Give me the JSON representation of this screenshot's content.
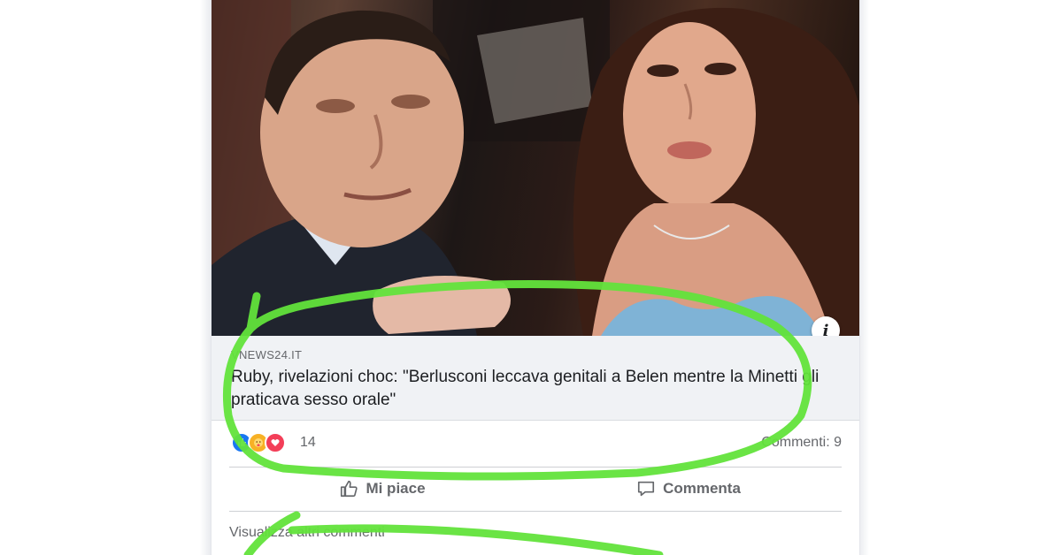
{
  "post": {
    "link_domain": "VNEWS24.IT",
    "link_title": "Ruby, rivelazioni choc: \"Berlusconi leccava genitali a Belen mentre la Minetti gli praticava sesso orale\"",
    "info_glyph": "i",
    "reactions": {
      "icons": [
        "like-icon",
        "care-icon",
        "love-icon"
      ],
      "count": "14"
    },
    "comments_label": "Commenti: 9",
    "actions": {
      "like_label": "Mi piace",
      "comment_label": "Commenta"
    },
    "more_comments_label": "Visualizza altri commenti"
  },
  "colors": {
    "annotation_green": "#62e33b",
    "facebook_blue": "#1877f2",
    "meta_background": "#f0f2f5",
    "secondary_text": "#65676b"
  }
}
